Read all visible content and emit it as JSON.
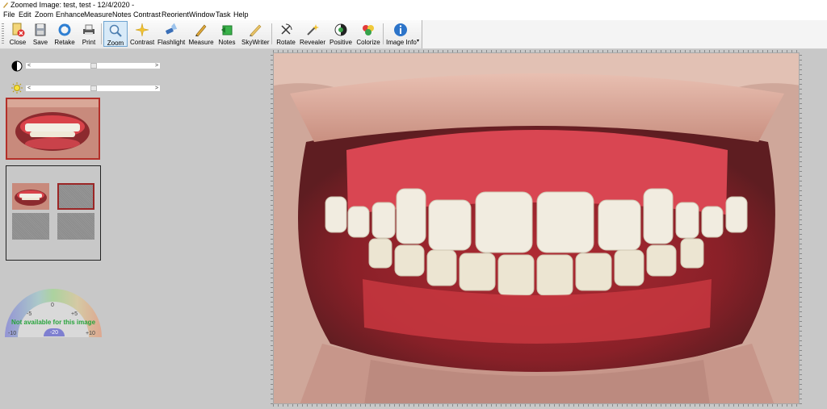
{
  "window": {
    "title": "Zoomed Image: test, test - 12/4/2020 -"
  },
  "menu": [
    "File",
    "Edit",
    "Zoom",
    "Enhance",
    "Measure",
    "Notes",
    "Contrast",
    "Reorient",
    "Window",
    "Task",
    "Help"
  ],
  "toolbar": {
    "close": "Close",
    "save": "Save",
    "retake": "Retake",
    "print": "Print",
    "zoom": "Zoom",
    "contrast": "Contrast",
    "flashlight": "Flashlight",
    "measure": "Measure",
    "notes": "Notes",
    "skywriter": "SkyWriter",
    "rotate": "Rotate",
    "revealer": "Revealer",
    "positive": "Positive",
    "colorize": "Colorize",
    "image_info": "Image Info"
  },
  "sliders": {
    "contrast": {
      "left_arrow": "<",
      "right_arrow": ">"
    },
    "brightness": {
      "left_arrow": "<",
      "right_arrow": ">"
    }
  },
  "gauge": {
    "labels": [
      "-10",
      "-5",
      "0",
      "+5",
      "+10"
    ],
    "current": "-20",
    "message": "Not available for this image"
  }
}
